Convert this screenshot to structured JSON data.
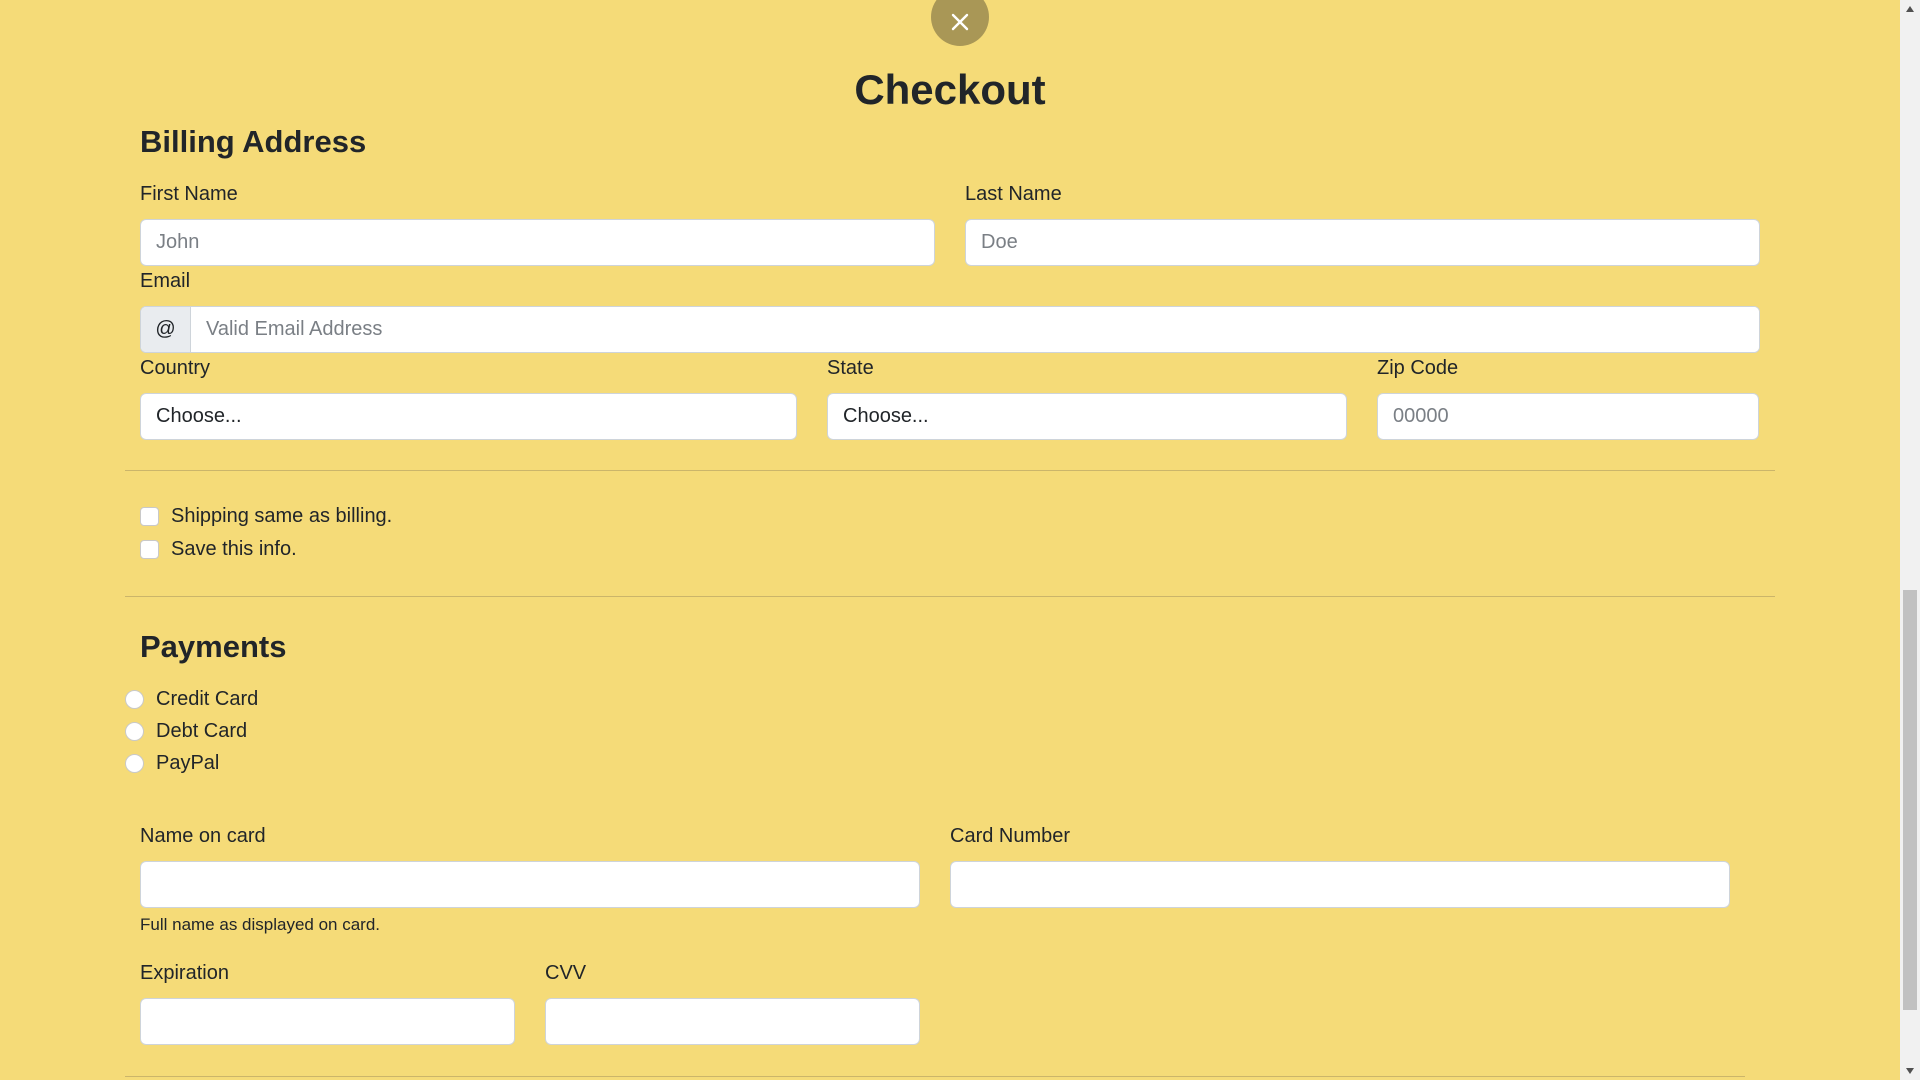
{
  "header": {
    "title": "Checkout",
    "close_icon": "close-icon"
  },
  "billing": {
    "heading": "Billing Address",
    "first_name": {
      "label": "First Name",
      "placeholder": "John",
      "value": ""
    },
    "last_name": {
      "label": "Last Name",
      "placeholder": "Doe",
      "value": ""
    },
    "email": {
      "label": "Email",
      "addon": "@",
      "placeholder": "Valid Email Address",
      "value": ""
    },
    "country": {
      "label": "Country",
      "selected": "Choose..."
    },
    "state": {
      "label": "State",
      "selected": "Choose..."
    },
    "zip": {
      "label": "Zip Code",
      "placeholder": "00000",
      "value": ""
    }
  },
  "options": {
    "shipping_same": "Shipping same as billing.",
    "save_info": "Save this info."
  },
  "payments": {
    "heading": "Payments",
    "methods": [
      "Credit Card",
      "Debt Card",
      "PayPal"
    ],
    "name_on_card": {
      "label": "Name on card",
      "help": "Full name as displayed on card."
    },
    "card_number": {
      "label": "Card Number"
    },
    "expiration": {
      "label": "Expiration"
    },
    "cvv": {
      "label": "CVV"
    }
  },
  "colors": {
    "background": "#f5db78",
    "close_button": "#a99756"
  }
}
